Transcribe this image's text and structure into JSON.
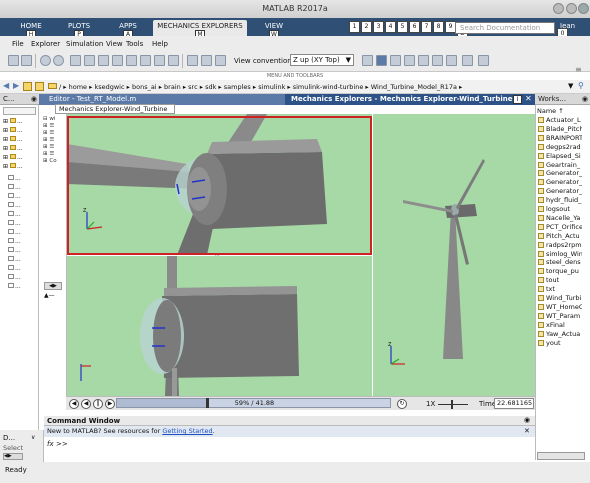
{
  "window_title": "MATLAB R2017a",
  "ribbon": {
    "tabs": [
      {
        "label": "HOME",
        "key": "H"
      },
      {
        "label": "PLOTS",
        "key": "P"
      },
      {
        "label": "APPS",
        "key": "A"
      },
      {
        "label": "MECHANICS EXPLORERS",
        "key": "M"
      },
      {
        "label": "VIEW",
        "key": "W"
      }
    ],
    "quick_access_keys": [
      "1",
      "2",
      "3",
      "4",
      "5",
      "6",
      "7",
      "8",
      "9",
      "D"
    ],
    "search_placeholder": "Search Documentation",
    "user": "Jean",
    "user_key": "0"
  },
  "menu": [
    "File",
    "Explorer",
    "Simulation",
    "View",
    "Tools",
    "Help"
  ],
  "toolbar": {
    "view_convention_label": "View convention:",
    "view_convention_value": "Z up (XY Top)",
    "section_label": "MENU AND TOOLBARS"
  },
  "address": {
    "path": [
      "/",
      "home",
      "ksedgwic",
      "bons_ai",
      "brain",
      "src",
      "sdk",
      "samples",
      "simulink",
      "simulink-wind-turbine",
      "Wind_Turbine_Model_R17a"
    ]
  },
  "current_folder_header": "C...",
  "editor": {
    "title": "Editor - Test_RT_Model.m",
    "tab": "Mechanics Explorer-Wind_Turbine"
  },
  "mechanics": {
    "title": "Mechanics Explorers - Mechanics Explorer-Wind_Turbine",
    "playback": "59% / 41.88",
    "speed": "1X",
    "time_label": "Time",
    "time_value": "22.681165"
  },
  "workspace": {
    "title": "Works...",
    "column": "Name ↑",
    "items": [
      "Actuator_L",
      "Blade_Pitch",
      "BRAINPORT",
      "degps2rad",
      "Elapsed_Si",
      "Geartrain_",
      "Generator_",
      "Generator_",
      "Generator_",
      "hydr_fluid_",
      "logsout",
      "Nacelle_Ya",
      "PCT_Orifice",
      "Pitch_Actu",
      "radps2rpm",
      "simlog_Win",
      "steel_dens",
      "torque_pu",
      "tout",
      "txt",
      "Wind_Turbi",
      "WT_HomeC",
      "WT_Param",
      "xFinal",
      "Yaw_Actua",
      "yout"
    ]
  },
  "command_window": {
    "title": "Command Window",
    "info_prefix": "New to MATLAB? See resources for",
    "info_link": "Getting Started",
    "info_suffix": ".",
    "prompt": ">>",
    "fx": "fx"
  },
  "left_bottom": {
    "detail": "D...",
    "select": "Select"
  },
  "status": "Ready",
  "colors": {
    "ribbon_bg": "#2f4f74",
    "viewport_bg": "#a7d9a6",
    "selected_border": "#cc2222"
  }
}
